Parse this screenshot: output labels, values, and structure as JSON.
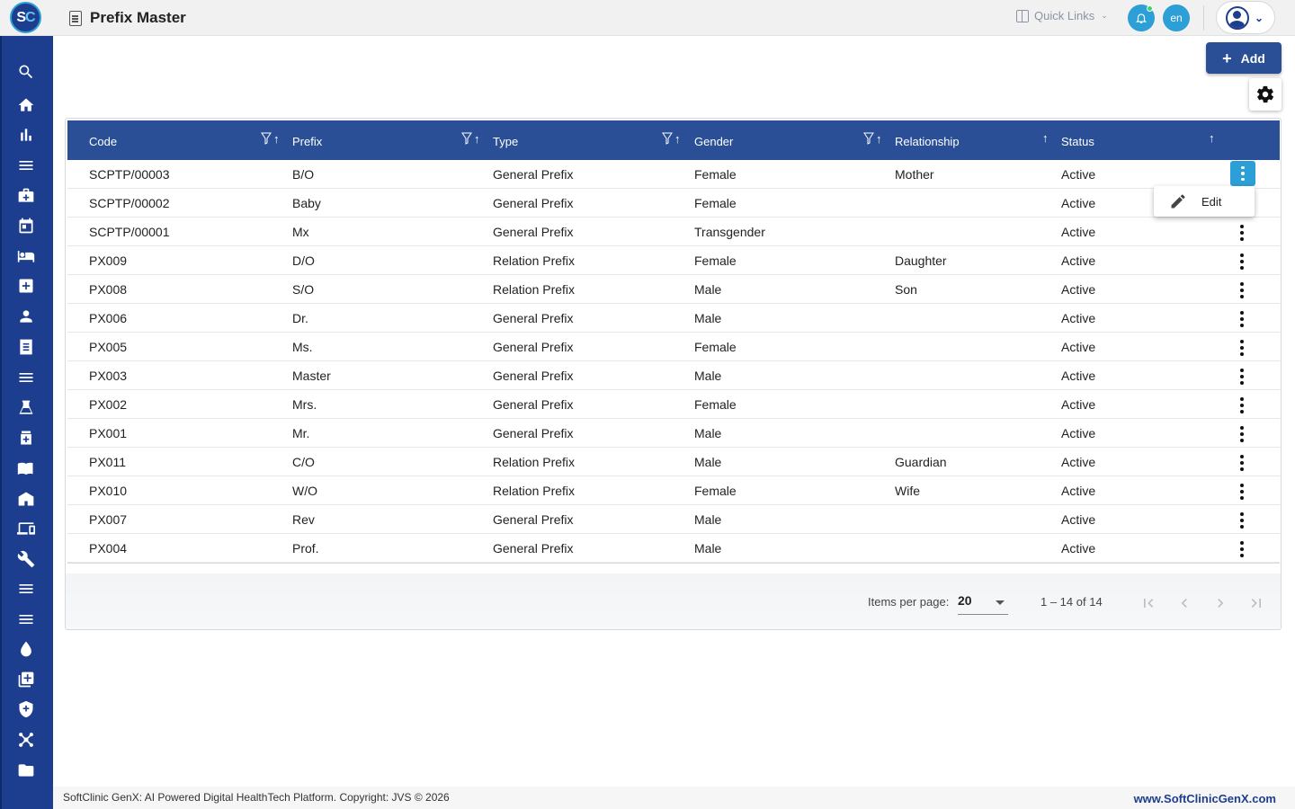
{
  "header": {
    "logo_text_s": "S",
    "logo_text_c": "C",
    "title": "Prefix Master",
    "quick_links": "Quick Links",
    "language": "en"
  },
  "toolbar": {
    "add_label": "Add"
  },
  "table": {
    "columns": [
      "Code",
      "Prefix",
      "Type",
      "Gender",
      "Relationship",
      "Status"
    ],
    "rows": [
      {
        "code": "SCPTP/00003",
        "prefix": "B/O",
        "type": "General Prefix",
        "gender": "Female",
        "relationship": "Mother",
        "status": "Active"
      },
      {
        "code": "SCPTP/00002",
        "prefix": "Baby",
        "type": "General Prefix",
        "gender": "Female",
        "relationship": "",
        "status": "Active"
      },
      {
        "code": "SCPTP/00001",
        "prefix": "Mx",
        "type": "General Prefix",
        "gender": "Transgender",
        "relationship": "",
        "status": "Active"
      },
      {
        "code": "PX009",
        "prefix": "D/O",
        "type": "Relation Prefix",
        "gender": "Female",
        "relationship": "Daughter",
        "status": "Active"
      },
      {
        "code": "PX008",
        "prefix": "S/O",
        "type": "Relation Prefix",
        "gender": "Male",
        "relationship": "Son",
        "status": "Active"
      },
      {
        "code": "PX006",
        "prefix": "Dr.",
        "type": "General Prefix",
        "gender": "Male",
        "relationship": "",
        "status": "Active"
      },
      {
        "code": "PX005",
        "prefix": "Ms.",
        "type": "General Prefix",
        "gender": "Female",
        "relationship": "",
        "status": "Active"
      },
      {
        "code": "PX003",
        "prefix": "Master",
        "type": "General Prefix",
        "gender": "Male",
        "relationship": "",
        "status": "Active"
      },
      {
        "code": "PX002",
        "prefix": "Mrs.",
        "type": "General Prefix",
        "gender": "Female",
        "relationship": "",
        "status": "Active"
      },
      {
        "code": "PX001",
        "prefix": "Mr.",
        "type": "General Prefix",
        "gender": "Male",
        "relationship": "",
        "status": "Active"
      },
      {
        "code": "PX011",
        "prefix": "C/O",
        "type": "Relation Prefix",
        "gender": "Male",
        "relationship": "Guardian",
        "status": "Active"
      },
      {
        "code": "PX010",
        "prefix": "W/O",
        "type": "Relation Prefix",
        "gender": "Female",
        "relationship": "Wife",
        "status": "Active"
      },
      {
        "code": "PX007",
        "prefix": "Rev",
        "type": "General Prefix",
        "gender": "Male",
        "relationship": "",
        "status": "Active"
      },
      {
        "code": "PX004",
        "prefix": "Prof.",
        "type": "General Prefix",
        "gender": "Male",
        "relationship": "",
        "status": "Active"
      }
    ]
  },
  "row_menu": {
    "edit_label": "Edit"
  },
  "paginator": {
    "items_per_page_label": "Items per page:",
    "items_per_page_value": "20",
    "range_label": "1 – 14 of 14"
  },
  "footer": {
    "copyright": "SoftClinic GenX: AI Powered Digital HealthTech Platform. Copyright: JVS © 2026",
    "website": "www.SoftClinicGenX.com"
  },
  "sidebar_icons": [
    "search-icon",
    "home-icon",
    "bar-chart-icon",
    "menu-icon",
    "medical-bag-icon",
    "calendar-icon",
    "bed-icon",
    "medical-cross-icon",
    "person-icon",
    "receipt-icon",
    "list-icon",
    "lab-icon",
    "medicine-bottle-icon",
    "book-icon",
    "store-icon",
    "devices-icon",
    "wrench-icon",
    "menu-icon",
    "menu-icon",
    "drop-icon",
    "library-add-icon",
    "shield-icon",
    "hub-icon",
    "folder-icon"
  ],
  "colors": {
    "primary": "#1d3e8f",
    "header_bg": "#2b4f96",
    "accent": "#2b9fd6"
  }
}
